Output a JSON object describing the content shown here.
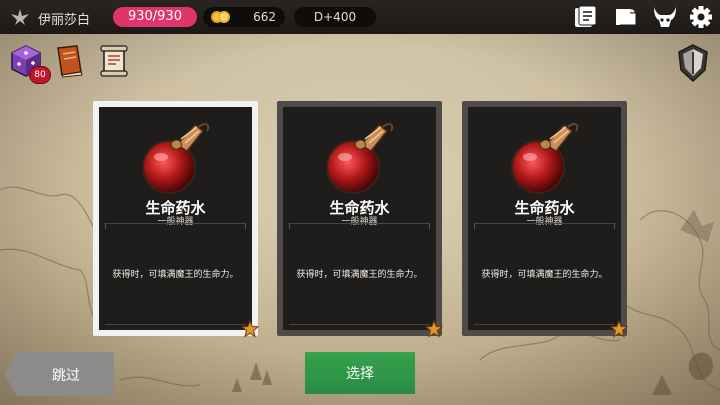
{
  "topbar": {
    "player_name": "伊丽莎白",
    "hp": "930/930",
    "gold": "662",
    "depth": "D+400",
    "icons": [
      "quest-card-icon",
      "map-scroll-icon",
      "demon-head-icon",
      "gear-icon"
    ]
  },
  "inventory": {
    "dice_count": "80",
    "icons": [
      "dice-icon",
      "spellbook-icon",
      "scroll-icon"
    ]
  },
  "cards": [
    {
      "name": "生命药水",
      "type": "一般神器",
      "desc": "获得时，可填满魔王的生命力。",
      "selected": true,
      "rarity_stars": 1
    },
    {
      "name": "生命药水",
      "type": "一般神器",
      "desc": "获得时，可填满魔王的生命力。",
      "selected": false,
      "rarity_stars": 1
    },
    {
      "name": "生命药水",
      "type": "一般神器",
      "desc": "获得时，可填满魔王的生命力。",
      "selected": false,
      "rarity_stars": 1
    }
  ],
  "buttons": {
    "skip": "跳过",
    "select": "选择"
  },
  "colors": {
    "hp_pill": "#e0356c",
    "select_button": "#2b8c43",
    "skip_button": "#8d8b89",
    "star": "#e0962a"
  }
}
